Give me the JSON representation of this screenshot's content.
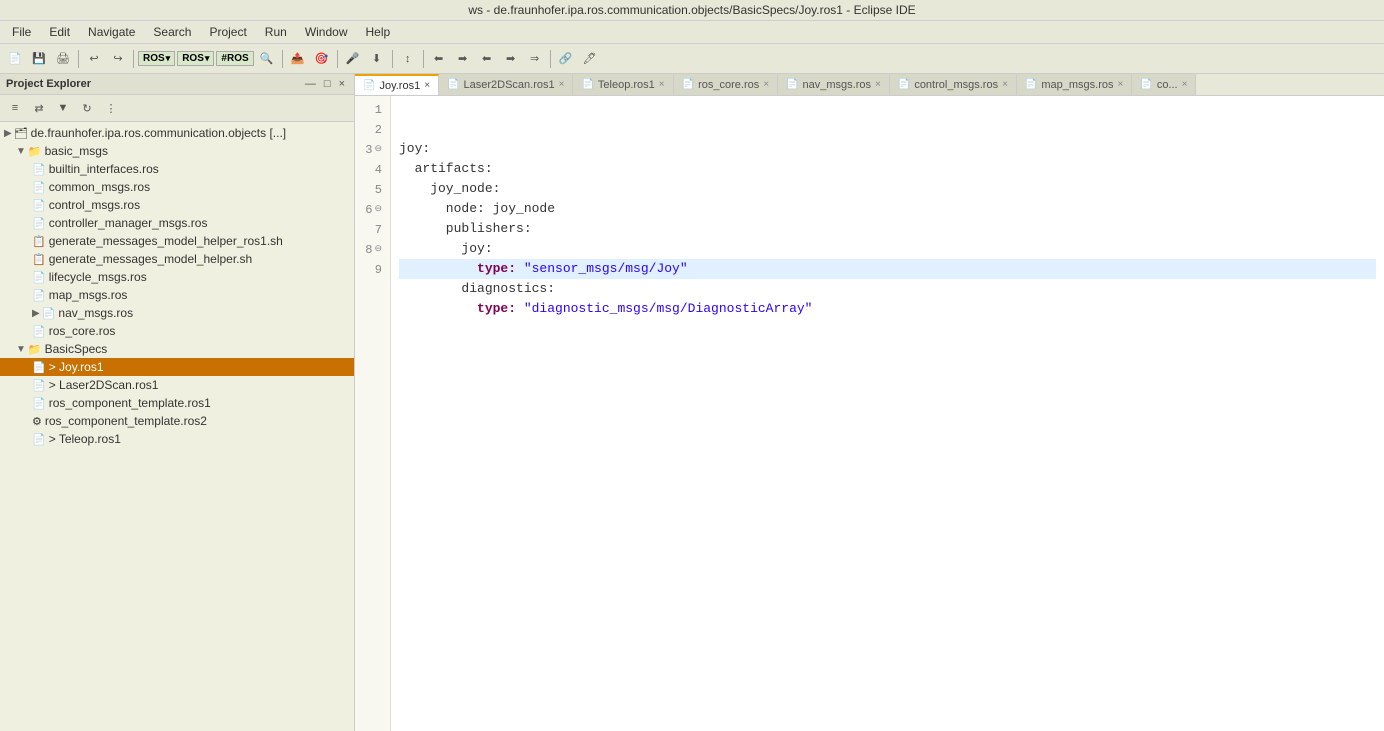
{
  "title_bar": {
    "text": "ws - de.fraunhofer.ipa.ros.communication.objects/BasicSpecs/Joy.ros1 - Eclipse IDE"
  },
  "menu": {
    "items": [
      "File",
      "Edit",
      "Navigate",
      "Search",
      "Project",
      "Run",
      "Window",
      "Help"
    ]
  },
  "sidebar": {
    "title": "Project Explorer",
    "close_label": "×",
    "collapse_label": "▾",
    "root_item": "de.fraunhofer.ipa.ros.communication.objects [...]",
    "groups": [
      {
        "label": "basic_msgs",
        "expanded": true,
        "children": [
          {
            "label": "builtin_interfaces.ros",
            "type": "file"
          },
          {
            "label": "common_msgs.ros",
            "type": "file"
          },
          {
            "label": "control_msgs.ros",
            "type": "file"
          },
          {
            "label": "controller_manager_msgs.ros",
            "type": "file"
          },
          {
            "label": "generate_messages_model_helper_ros1.sh",
            "type": "file-script"
          },
          {
            "label": "generate_messages_model_helper.sh",
            "type": "file-script"
          },
          {
            "label": "lifecycle_msgs.ros",
            "type": "file"
          },
          {
            "label": "map_msgs.ros",
            "type": "file"
          },
          {
            "label": "nav_msgs.ros",
            "type": "file"
          },
          {
            "label": "ros_core.ros",
            "type": "file"
          }
        ]
      },
      {
        "label": "BasicSpecs",
        "expanded": true,
        "children": [
          {
            "label": "> Joy.ros1",
            "type": "file",
            "selected": true
          },
          {
            "label": "> Laser2DScan.ros1",
            "type": "file"
          },
          {
            "label": "ros_component_template.ros1",
            "type": "file"
          },
          {
            "label": "ros_component_template.ros2",
            "type": "file-gear"
          },
          {
            "label": "> Teleop.ros1",
            "type": "file"
          }
        ]
      }
    ]
  },
  "tabs": [
    {
      "label": "Joy.ros1",
      "active": true,
      "closeable": true
    },
    {
      "label": "Laser2DScan.ros1",
      "active": false,
      "closeable": true
    },
    {
      "label": "Teleop.ros1",
      "active": false,
      "closeable": true
    },
    {
      "label": "ros_core.ros",
      "active": false,
      "closeable": true
    },
    {
      "label": "nav_msgs.ros",
      "active": false,
      "closeable": true
    },
    {
      "label": "control_msgs.ros",
      "active": false,
      "closeable": true
    },
    {
      "label": "map_msgs.ros",
      "active": false,
      "closeable": true
    },
    {
      "label": "co...",
      "active": false,
      "closeable": true
    }
  ],
  "code": {
    "lines": [
      {
        "num": 1,
        "fold": false,
        "content": [
          {
            "t": "plain",
            "v": "joy:"
          }
        ]
      },
      {
        "num": 2,
        "fold": false,
        "content": [
          {
            "t": "plain",
            "v": "  artifacts:"
          }
        ]
      },
      {
        "num": 3,
        "fold": true,
        "content": [
          {
            "t": "plain",
            "v": "    joy_node:"
          }
        ]
      },
      {
        "num": 4,
        "fold": false,
        "content": [
          {
            "t": "plain",
            "v": "      node: joy_node"
          }
        ]
      },
      {
        "num": 5,
        "fold": false,
        "content": [
          {
            "t": "plain",
            "v": "      publishers:"
          }
        ]
      },
      {
        "num": 6,
        "fold": true,
        "content": [
          {
            "t": "plain",
            "v": "        joy:"
          }
        ]
      },
      {
        "num": 7,
        "fold": false,
        "content": [
          {
            "t": "key",
            "v": "          type: "
          },
          {
            "t": "string",
            "v": "\"sensor_msgs/msg/Joy\""
          }
        ],
        "highlighted": true
      },
      {
        "num": 8,
        "fold": true,
        "content": [
          {
            "t": "plain",
            "v": "        diagnostics:"
          }
        ]
      },
      {
        "num": 9,
        "fold": false,
        "content": [
          {
            "t": "key",
            "v": "          type: "
          },
          {
            "t": "string",
            "v": "\"diagnostic_msgs/msg/DiagnosticArray\""
          }
        ]
      }
    ]
  }
}
